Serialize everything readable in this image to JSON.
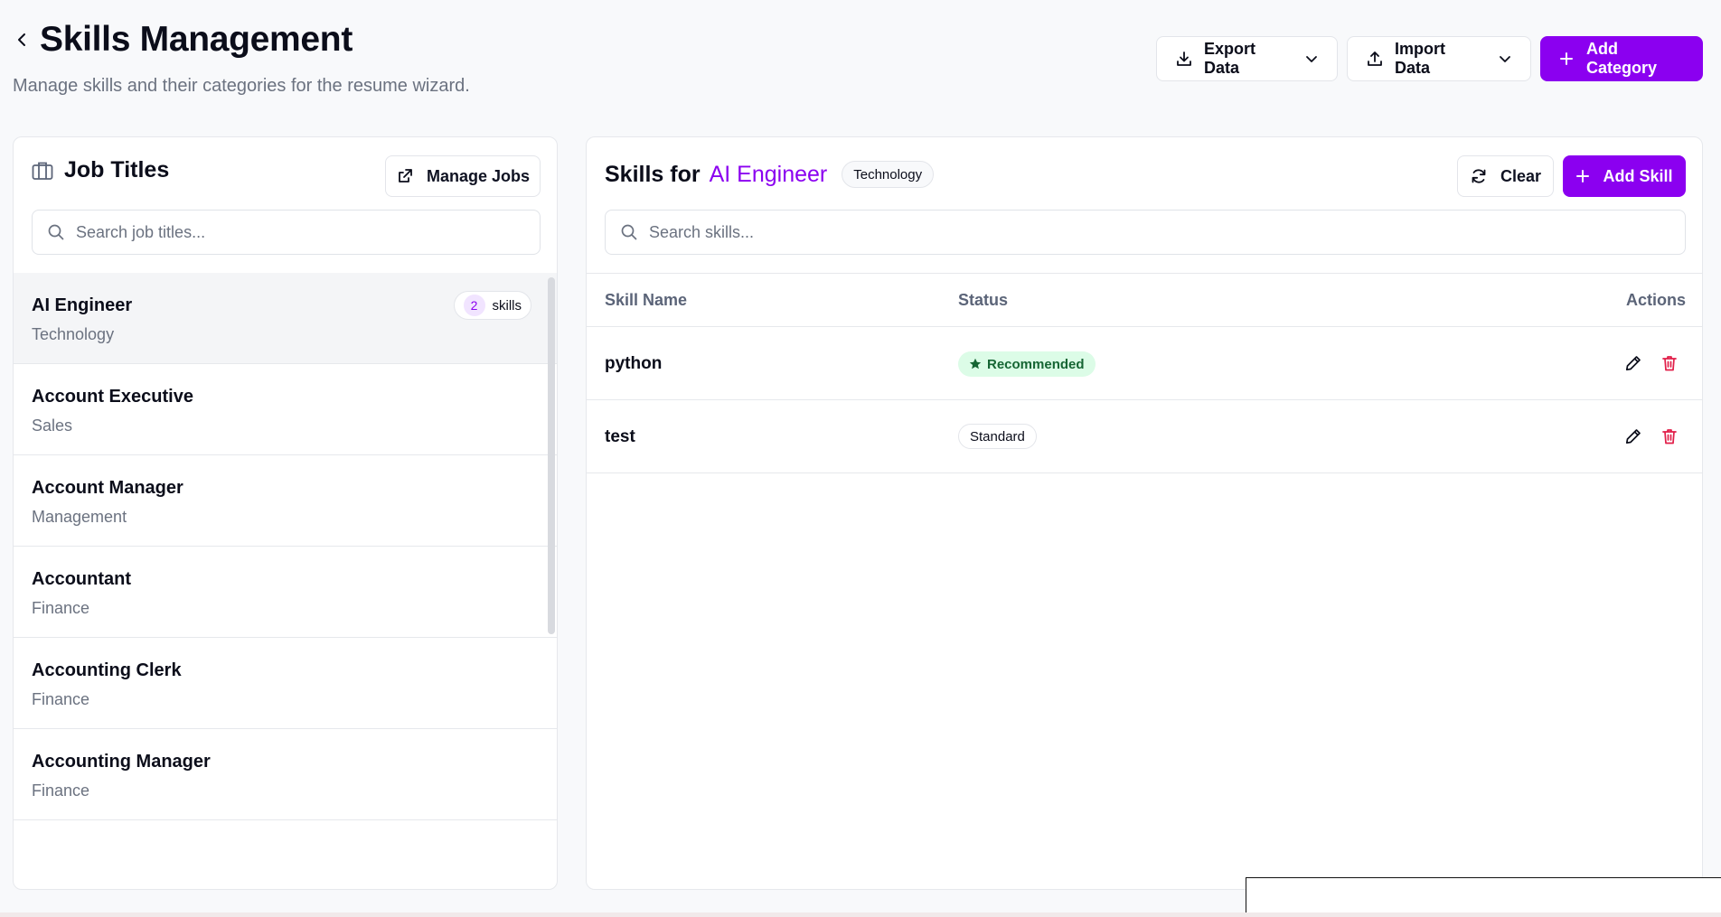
{
  "header": {
    "title": "Skills Management",
    "subtitle": "Manage skills and their categories for the resume wizard.",
    "export_label": "Export Data",
    "import_label": "Import Data",
    "add_category_label": "Add Category"
  },
  "left_panel": {
    "title": "Job Titles",
    "manage_jobs_label": "Manage Jobs",
    "search_placeholder": "Search job titles...",
    "jobs": [
      {
        "name": "AI Engineer",
        "category": "Technology",
        "skill_count": "2",
        "skill_count_suffix": "skills"
      },
      {
        "name": "Account Executive",
        "category": "Sales"
      },
      {
        "name": "Account Manager",
        "category": "Management"
      },
      {
        "name": "Accountant",
        "category": "Finance"
      },
      {
        "name": "Accounting Clerk",
        "category": "Finance"
      },
      {
        "name": "Accounting Manager",
        "category": "Finance"
      }
    ]
  },
  "right_panel": {
    "title_prefix": "Skills for",
    "selected_job": "AI Engineer",
    "selected_category": "Technology",
    "clear_label": "Clear",
    "add_skill_label": "Add Skill",
    "search_placeholder": "Search skills...",
    "columns": {
      "name": "Skill Name",
      "status": "Status",
      "actions": "Actions"
    },
    "skills": [
      {
        "name": "python",
        "status": "Recommended"
      },
      {
        "name": "test",
        "status": "Standard"
      }
    ]
  },
  "colors": {
    "accent": "#8b00f0",
    "recommended_bg": "#dcfce7",
    "recommended_fg": "#166534",
    "delete_red": "#e11d48"
  }
}
